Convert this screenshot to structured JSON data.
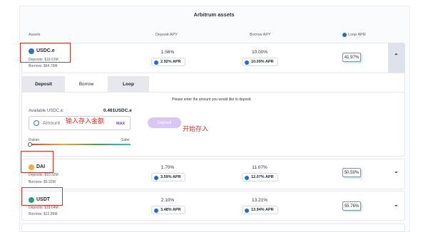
{
  "title": "Arbitrum assets",
  "columns": {
    "assets": "Assets",
    "deposit_apy": "Deposit APY",
    "borrow_apy": "Borrow APY",
    "loop_apr": "Loop APR"
  },
  "rows": [
    {
      "name": "USDC.e",
      "deposits": "Deposits: $19.61M",
      "borrows": "Borrows: $64.76M",
      "deposit_apy": "1.56%",
      "deposit_apr": "2.92% APR",
      "borrow_apy": "10.00%",
      "borrow_apr": "10.09% APR",
      "loop_apr": "41.97%",
      "coin_color": "#2775ca",
      "expanded": true
    },
    {
      "name": "DAI",
      "deposits": "Deposits: $10.32M",
      "borrows": "Borrows: $6.92M",
      "deposit_apy": "1.70%",
      "deposit_apr": "3.59% APR",
      "borrow_apy": "11.07%",
      "borrow_apr": "12.07% APR",
      "loop_apr": "50.59%",
      "coin_color": "#f5ac37",
      "expanded": false
    },
    {
      "name": "USDT",
      "deposits": "Deposits: $18.64M",
      "borrows": "Borrows: $12.86M",
      "deposit_apy": "2.10%",
      "deposit_apr": "3.48% APR",
      "borrow_apy": "13.21%",
      "borrow_apr": "13.94% APR",
      "loop_apr": "55.76%",
      "coin_color": "#26a17b",
      "expanded": false
    }
  ],
  "tabs": [
    "Deposit",
    "Borrow",
    "Loop"
  ],
  "deposit_form": {
    "hint": "Please enter the amount you would like to deposit.",
    "available_label": "Available USDC.e:",
    "available_value": "0.461",
    "available_unit": "USDC.e",
    "amount_placeholder": "Amount",
    "max_label": "MAX",
    "deposit_button": "Deposit",
    "riskier_label": "Riskier",
    "safer_label": "Safer",
    "risk_level": 0.05
  },
  "annotations": {
    "enter_amount": "输入存入金额",
    "start_deposit": "开始存入"
  },
  "colors": {
    "accent_purple": "#6a3fe0",
    "red_annotation": "#d93025",
    "apr_icon": "#1a6dd8"
  }
}
